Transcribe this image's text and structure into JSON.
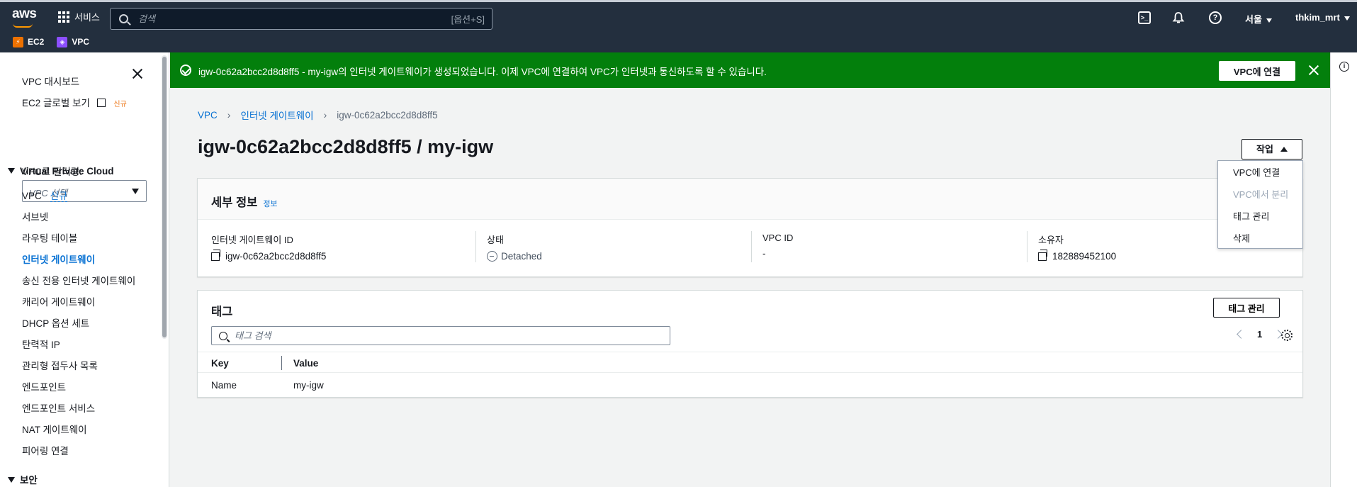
{
  "topnav": {
    "logo": "aws",
    "services_label": "서비스",
    "search_placeholder": "검색",
    "search_shortcut": "[옵션+S]",
    "region": "서울",
    "user": "thkim_mrt",
    "icons": [
      "grid-icon",
      "search-icon",
      "cloudshell-icon",
      "bell-icon",
      "help-icon"
    ]
  },
  "favorites": [
    {
      "label": "EC2",
      "color": "#ed7100"
    },
    {
      "label": "VPC",
      "color": "#8c4fff"
    }
  ],
  "sidebar": {
    "dashboard": "VPC 대시보드",
    "ec2_global": "EC2 글로벌 보기",
    "ec2_global_badge": "신규",
    "filter_label": "VPC로 필터링:",
    "filter_placeholder": "VPC 선택",
    "section_vpc": "Virtual Private Cloud",
    "items": [
      {
        "label": "VPC",
        "badge": "신규"
      },
      {
        "label": "서브넷"
      },
      {
        "label": "라우팅 테이블"
      },
      {
        "label": "인터넷 게이트웨이"
      },
      {
        "label": "송신 전용 인터넷 게이트웨이"
      },
      {
        "label": "캐리어 게이트웨이"
      },
      {
        "label": "DHCP 옵션 세트"
      },
      {
        "label": "탄력적 IP"
      },
      {
        "label": "관리형 접두사 목록"
      },
      {
        "label": "엔드포인트"
      },
      {
        "label": "엔드포인트 서비스"
      },
      {
        "label": "NAT 게이트웨이"
      },
      {
        "label": "피어링 연결"
      }
    ],
    "section_security": "보안"
  },
  "flash": {
    "message": "igw-0c62a2bcc2d8d8ff5 - my-igw의 인터넷 게이트웨이가 생성되었습니다. 이제 VPC에 연결하여 VPC가 인터넷과 통신하도록 할 수 있습니다.",
    "action": "VPC에 연결",
    "color": "#037f0c"
  },
  "breadcrumb": {
    "root": "VPC",
    "parent": "인터넷 게이트웨이",
    "current": "igw-0c62a2bcc2d8d8ff5"
  },
  "page": {
    "title": "igw-0c62a2bcc2d8d8ff5 / my-igw",
    "actions_label": "작업"
  },
  "actions_menu": [
    {
      "label": "VPC에 연결",
      "disabled": false
    },
    {
      "label": "VPC에서 분리",
      "disabled": true
    },
    {
      "label": "태그 관리",
      "disabled": false
    },
    {
      "label": "삭제",
      "disabled": false
    }
  ],
  "details": {
    "heading": "세부 정보",
    "info_link": "정보",
    "fields": [
      {
        "label": "인터넷 게이트웨이 ID",
        "value": "igw-0c62a2bcc2d8d8ff5"
      },
      {
        "label": "상태",
        "value": "Detached"
      },
      {
        "label": "VPC ID",
        "value": "-"
      },
      {
        "label": "소유자",
        "value": "182889452100"
      }
    ]
  },
  "tags": {
    "heading": "태그",
    "manage_label": "태그 관리",
    "search_placeholder": "태그 검색",
    "page": "1",
    "columns": [
      "Key",
      "Value"
    ],
    "rows": [
      {
        "key": "Name",
        "value": "my-igw"
      }
    ]
  }
}
